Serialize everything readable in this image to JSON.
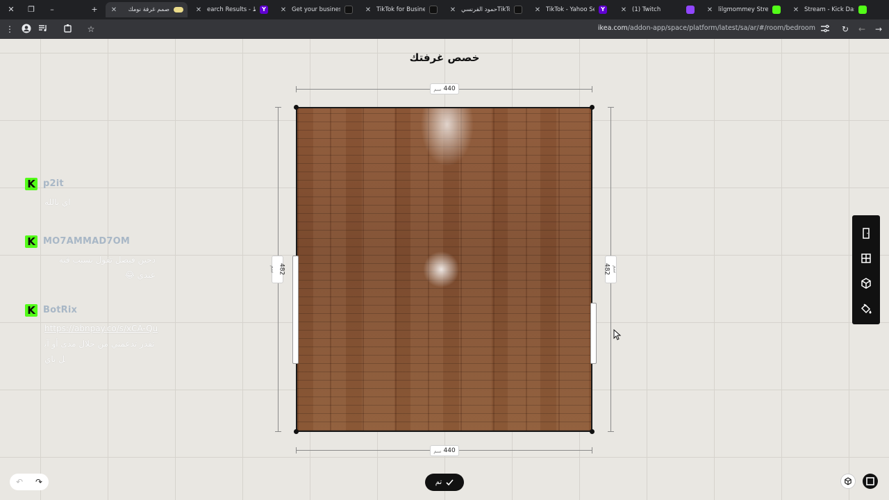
{
  "browser": {
    "tabs": [
      {
        "title": "صمم غرفة نومك",
        "favicon": "ikea-icon",
        "active": true
      },
      {
        "title": "earch Results - ايكياط",
        "favicon": "yahoo-icon"
      },
      {
        "title": "Get your business di",
        "favicon": "tiktok-icon"
      },
      {
        "title": "TikTok for Business |",
        "favicon": "tiktok-icon"
      },
      {
        "title": "حمود الفرنسيTikTok |",
        "favicon": "tiktok-icon"
      },
      {
        "title": "TikTok - Yahoo Searc",
        "favicon": "yahoo-icon"
      },
      {
        "title": "(1) Twitch",
        "favicon": "twitch-icon"
      },
      {
        "title": "lilgmommey Stream",
        "favicon": "kick-icon"
      },
      {
        "title": "Stream - Kick Dashbo",
        "favicon": "kick-icon"
      }
    ],
    "url_domain": "ikea.com",
    "url_path": "/addon-app/space/platform/latest/sa/ar/#/room/bedroom"
  },
  "planner": {
    "heading": "خصص غرفتك",
    "width_value": "440",
    "height_value": "482",
    "unit": "سم",
    "done_label": "تم",
    "floor_color": "#7f4e30"
  },
  "chat": {
    "messages": [
      {
        "username": "p2it",
        "text": "اي بالله"
      },
      {
        "username": "MO7AMMAD7OM",
        "text": "دحين فيصل تقول بسبب قبه عبدي 😂"
      },
      {
        "username": "BotRix",
        "link": "https://abnpay.co/s/xCA-Qu",
        "text": "تقدر تدعمني من خلال مدى أو آبل باي"
      }
    ]
  }
}
